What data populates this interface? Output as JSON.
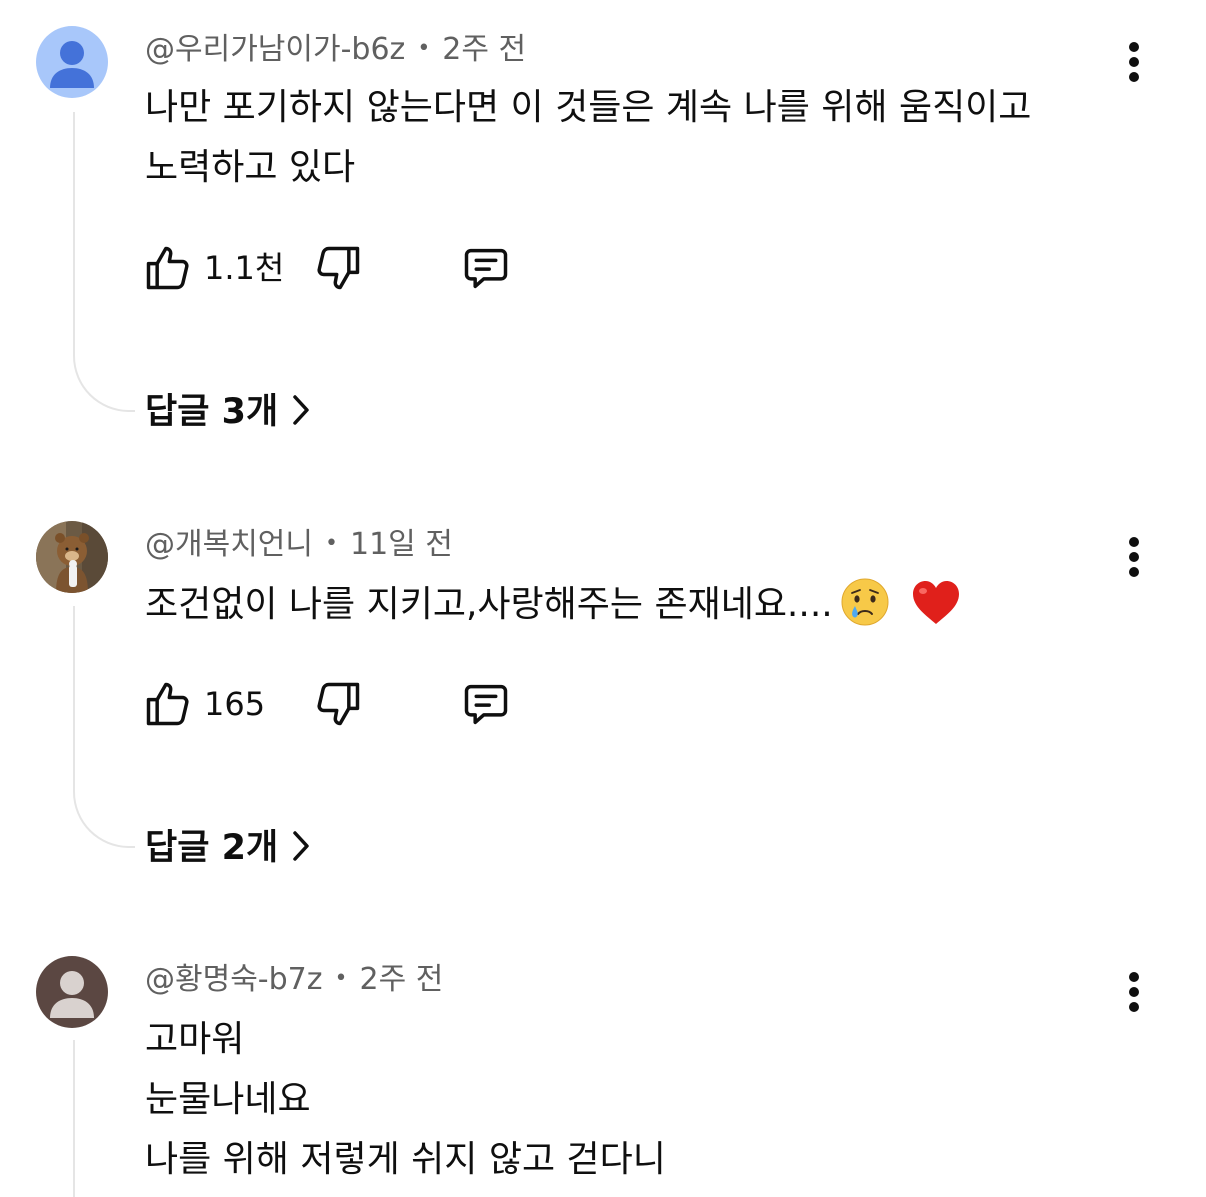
{
  "comments": [
    {
      "author": "@우리가남이가-b6z",
      "time": "2주 전",
      "lines": [
        "나만 포기하지 않는다면 이 것들은 계속 나를 위해 움직이고",
        "노력하고 있다"
      ],
      "likes": "1.1천",
      "replies_label": "답글 3개",
      "avatar": "default-blue"
    },
    {
      "author": "@개복치언니",
      "time": "11일 전",
      "lines": [
        "조건없이 나를 지키고,사랑해주는 존재네요...."
      ],
      "emojis": [
        "crying-face",
        "red-heart"
      ],
      "likes": "165",
      "replies_label": "답글 2개",
      "avatar": "bear-photo"
    },
    {
      "author": "@황명숙-b7z",
      "time": "2주 전",
      "lines": [
        "고마워",
        "눈물나네요",
        "나를 위해 저렇게 쉬지 않고 걷다니"
      ],
      "avatar": "default-brown"
    }
  ],
  "separator": "•",
  "icons": {
    "like": "thumbs-up-icon",
    "dislike": "thumbs-down-icon",
    "reply": "comment-icon",
    "more": "more-vert-icon",
    "chevron": "chevron-right-icon"
  },
  "colors": {
    "text": "#0f0f0f",
    "meta": "#606060",
    "thread_line": "#e5e5e5",
    "avatar_blue_bg": "#a8c7fa",
    "avatar_blue_fg": "#4472d9",
    "avatar_brown_bg": "#5b4742",
    "avatar_brown_fg": "#d9d2cf"
  }
}
